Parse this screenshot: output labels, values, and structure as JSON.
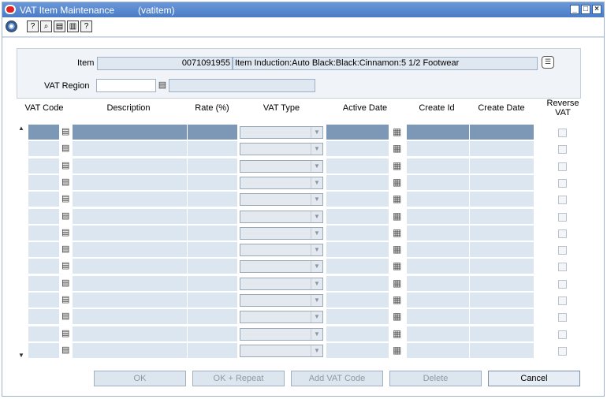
{
  "window": {
    "title": "VAT Item Maintenance",
    "code": "(vatitem)",
    "controls": [
      "minimize-icon",
      "maximize-icon",
      "close-icon"
    ]
  },
  "toolbar": {
    "icons": [
      "globe-icon",
      "help-icon",
      "find-icon",
      "save-icon",
      "print-icon",
      "question-icon"
    ]
  },
  "form": {
    "item_label": "Item",
    "item_number": "0071091955",
    "item_description": "Item Induction:Auto Black:Black:Cinnamon:5 1/2 Footwear",
    "vat_region_label": "VAT Region",
    "vat_region_value": "",
    "vat_region_desc": ""
  },
  "grid": {
    "columns": [
      "VAT Code",
      "Description",
      "Rate (%)",
      "VAT Type",
      "Active Date",
      "Create Id",
      "Create Date",
      "Reverse VAT"
    ],
    "row_count": 14,
    "selected_row": 0
  },
  "buttons": {
    "ok": "OK",
    "ok_repeat": "OK + Repeat",
    "add_vat_code": "Add VAT Code",
    "delete": "Delete",
    "cancel": "Cancel"
  }
}
